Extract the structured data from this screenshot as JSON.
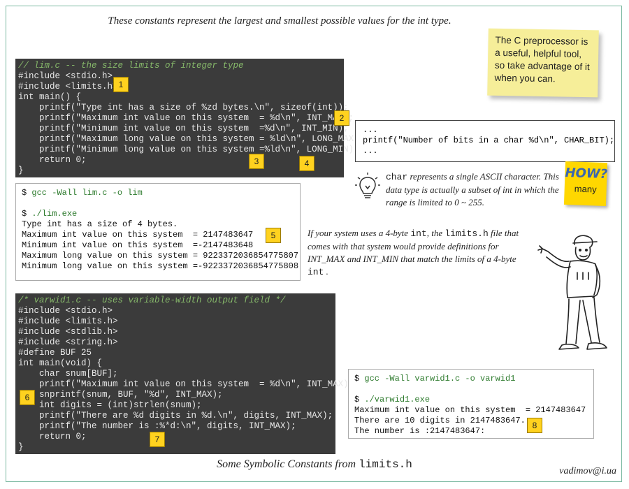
{
  "top_caption": "These constants represent the largest and smallest possible values for the int type.",
  "code1": {
    "comment": "// lim.c -- the size limits of integer type",
    "lines": [
      "#include <stdio.h>",
      "#include <limits.h>",
      "int main() {",
      "    printf(\"Type int has a size of %zd bytes.\\n\", sizeof(int));",
      "    printf(\"Maximum int value on this system  = %d\\n\", INT_MAX);",
      "    printf(\"Minimum int value on this system  =%d\\n\", INT_MIN);",
      "    printf(\"Maximum long value on this system = %ld\\n\", LONG_MAX);",
      "    printf(\"Minimum long value on this system =%ld\\n\", LONG_MIN);",
      "    return 0;",
      "}"
    ]
  },
  "term1": {
    "prompt": "$",
    "command": "gcc -Wall lim.c -o lim",
    "run_command": "./lim.exe",
    "lines": [
      "Type int has a size of 4 bytes.",
      "Maximum int value on this system  = 2147483647",
      "Minimum int value on this system  =-2147483648",
      "Maximum long value on this system = 9223372036854775807",
      "Minimum long value on this system =-9223372036854775808"
    ]
  },
  "sticky_note": "The C preprocessor is a useful, helpful tool, so take advantage of it when you can.",
  "torn_paper": {
    "lines": [
      "...",
      "printf(\"Number of bits in a char %d\\n\", CHAR_BIT);",
      "..."
    ]
  },
  "char_note": {
    "mono": "char",
    "text": " represents a single ASCII character. This data type is actually a subset of int in which the range is limited to 0 ~ 255."
  },
  "howmany": {
    "line1": "HOW?",
    "line2": "many"
  },
  "desc_note": {
    "p1": "If your system uses a 4-byte ",
    "m1": "int",
    "p2": ", the ",
    "m2": "limits.h",
    "p3": " file that comes with that system would provide definitions for INT_MAX  and INT_MIN that match the limits of a 4-byte ",
    "m3": "int",
    "p4": " ."
  },
  "code2": {
    "comment": "/* varwid1.c -- uses variable-width output field */",
    "lines": [
      "#include <stdio.h>",
      "#include <limits.h>",
      "#include <stdlib.h>",
      "#include <string.h>",
      "#define BUF 25",
      "int main(void) {",
      "    char snum[BUF];",
      "    printf(\"Maximum int value on this system  = %d\\n\", INT_MAX);",
      "    snprintf(snum, BUF, \"%d\", INT_MAX);",
      "    int digits = (int)strlen(snum);",
      "    printf(\"There are %d digits in %d.\\n\", digits, INT_MAX);",
      "    printf(\"The number is :%*d:\\n\", digits, INT_MAX);",
      "    return 0;",
      "}"
    ]
  },
  "term2": {
    "prompt": "$",
    "command": "gcc -Wall varwid1.c -o varwid1",
    "run_command": "./varwid1.exe",
    "lines": [
      "Maximum int value on this system  = 2147483647",
      "There are 10 digits in 2147483647.",
      "The number is :2147483647:"
    ]
  },
  "badges": [
    "1",
    "2",
    "3",
    "4",
    "5",
    "6",
    "7",
    "8"
  ],
  "bottom_caption": {
    "text": "Some Symbolic Constants from ",
    "mono": "limits.h"
  },
  "email": "vadimov@i.ua",
  "colors": {
    "code_bg": "#3b3b3b",
    "badge": "#ffd21f",
    "sticky": "#f6ee99",
    "frame": "#7ab8a0"
  }
}
